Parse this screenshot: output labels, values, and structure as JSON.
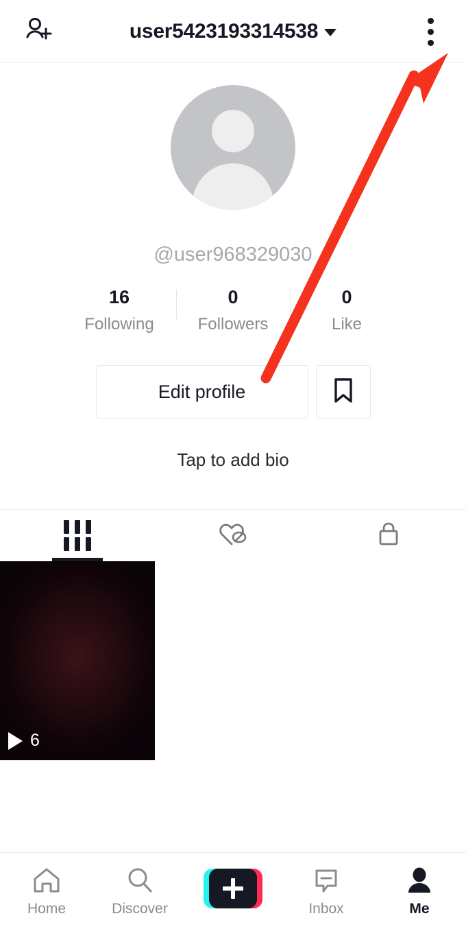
{
  "header": {
    "title": "user5423193314538",
    "dropdown_icon": "chevron-down-icon",
    "add_friend_icon": "add-person-icon",
    "more_icon": "three-dots-vertical-icon"
  },
  "profile": {
    "avatar_icon": "default-avatar-placeholder",
    "handle": "@user968329030",
    "bio_placeholder": "Tap to add bio",
    "stats": [
      {
        "value": "16",
        "label": "Following"
      },
      {
        "value": "0",
        "label": "Followers"
      },
      {
        "value": "0",
        "label": "Like"
      }
    ],
    "edit_button": "Edit profile",
    "bookmark_icon": "bookmark-icon"
  },
  "tabs": [
    {
      "icon": "grid-icon",
      "name": "videos",
      "active": true
    },
    {
      "icon": "heart-slash-icon",
      "name": "liked-hidden",
      "active": false
    },
    {
      "icon": "lock-icon",
      "name": "private",
      "active": false
    }
  ],
  "videos": [
    {
      "play_count": "6",
      "play_icon": "play-triangle-icon"
    }
  ],
  "bottom_nav": [
    {
      "label": "Home",
      "icon": "home-icon",
      "active": false
    },
    {
      "label": "Discover",
      "icon": "search-icon",
      "active": false
    },
    {
      "label": "",
      "icon": "create-plus-button",
      "active": false
    },
    {
      "label": "Inbox",
      "icon": "message-minus-icon",
      "active": false
    },
    {
      "label": "Me",
      "icon": "person-filled-icon",
      "active": true
    }
  ],
  "annotation": {
    "arrow_color": "#f4321d",
    "arrow_target": "three-dots-vertical-icon"
  },
  "colors": {
    "text_primary": "#161823",
    "text_muted": "#8a8b8f",
    "border": "#ececec",
    "tiktok_cyan": "#25f4ee",
    "tiktok_pink": "#fe2c55"
  }
}
